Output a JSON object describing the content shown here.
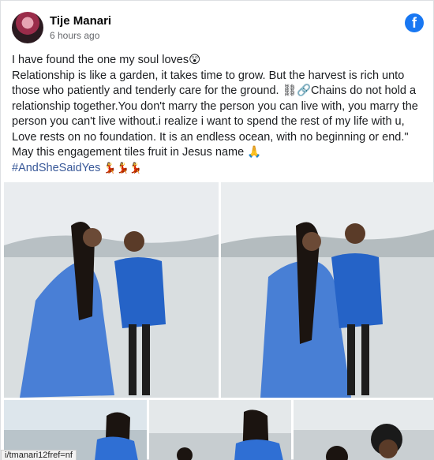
{
  "post": {
    "author": "Tije Manari",
    "time": "6 hours ago",
    "logo_icon": "facebook-icon",
    "paragraphs": [
      "I have found the one my soul loves😲",
      "Relationship is like a garden, it takes time to grow. But the harvest is rich unto those who patiently and tenderly care for the ground. ⛓🔗Chains do not hold a relationship together.You don't marry the person you can live with, you marry the person you can't live without.i realize i want to spend the rest of my life with u, Love rests on no foundation. It is an endless ocean, with no beginning or end.\" May this engagement tiles fruit in Jesus name 🙏"
    ],
    "hashtag": "#AndSheSaidYes",
    "hashtag_emoji": "💃💃💃"
  },
  "status_bar": {
    "url": "i/tmanari12fref=nf"
  },
  "colors": {
    "facebook_blue": "#1877f2",
    "hashtag": "#385898",
    "dress_blue": "#2f6fd4"
  }
}
